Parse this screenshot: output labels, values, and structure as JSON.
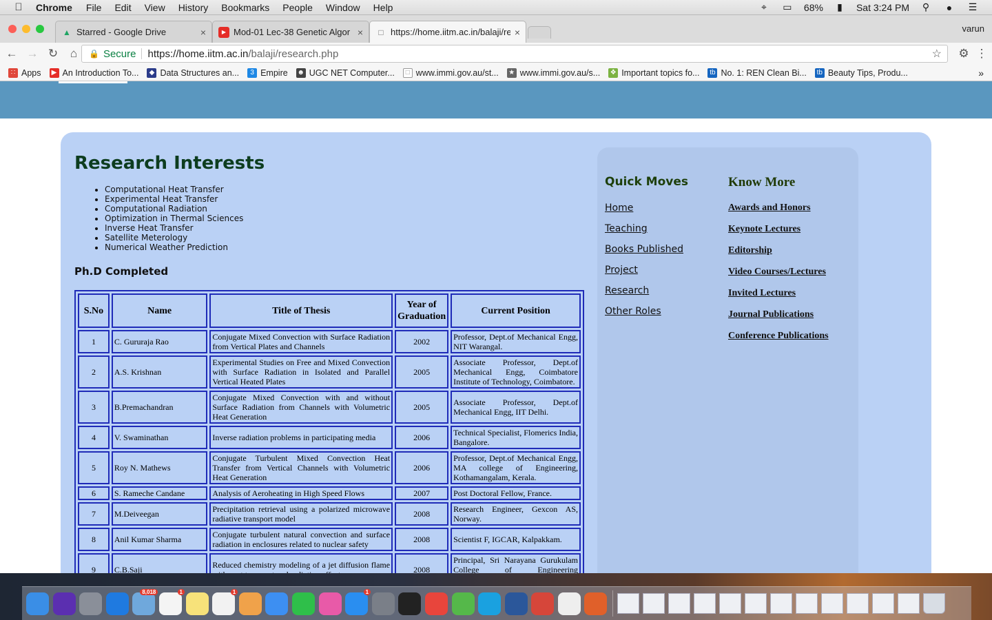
{
  "menubar": {
    "app": "Chrome",
    "items": [
      "File",
      "Edit",
      "View",
      "History",
      "Bookmarks",
      "People",
      "Window",
      "Help"
    ],
    "battery": "68%",
    "clock": "Sat 3:24 PM"
  },
  "tabs": [
    {
      "title": "Starred - Google Drive",
      "icon": "google-drive-icon"
    },
    {
      "title": "Mod-01 Lec-38 Genetic Algor",
      "icon": "youtube-icon"
    },
    {
      "title": "https://home.iitm.ac.in/balaji/re",
      "icon": "page-icon",
      "active": true
    }
  ],
  "profile": "varun",
  "omnibox": {
    "secure_label": "Secure",
    "url_host": "https://home.iitm.ac.in",
    "url_path": "/balaji/research.php"
  },
  "bookmarks": [
    {
      "label": "Apps",
      "color": "#e0483b"
    },
    {
      "label": "An Introduction To...",
      "color": "#e52d27"
    },
    {
      "label": "Data Structures an...",
      "color": "#2b3b8a"
    },
    {
      "label": "Empire",
      "color": "#1e88e5"
    },
    {
      "label": "UGC NET Computer...",
      "color": "#444444"
    },
    {
      "label": "www.immi.gov.au/st...",
      "color": "#999999"
    },
    {
      "label": "www.immi.gov.au/s...",
      "color": "#666666"
    },
    {
      "label": "Important topics fo...",
      "color": "#7cb342"
    },
    {
      "label": "No. 1: REN Clean Bi...",
      "color": "#1565c0"
    },
    {
      "label": "Beauty Tips, Produ...",
      "color": "#1565c0"
    }
  ],
  "page": {
    "research_title": "Research Interests",
    "interests": [
      "Computational Heat Transfer",
      "Experimental Heat Transfer",
      "Computational Radiation",
      "Optimization in Thermal Sciences",
      "Inverse Heat Transfer",
      "Satellite Meterology",
      "Numerical Weather Prediction"
    ],
    "phd_title": "Ph.D Completed",
    "table": {
      "headers": [
        "S.No",
        "Name",
        "Title of Thesis",
        "Year of Graduation",
        "Current Position"
      ],
      "rows": [
        [
          "1",
          "C. Gururaja Rao",
          "Conjugate Mixed Convection with Surface Radiation from Vertical Plates and Channels",
          "2002",
          "Professor, Dept.of Mechanical Engg, NIT Warangal."
        ],
        [
          "2",
          "A.S. Krishnan",
          "Experimental Studies on Free and Mixed Convection with Surface Radiation in Isolated and Parallel Vertical Heated Plates",
          "2005",
          "Associate Professor, Dept.of Mechanical Engg, Coimbatore Institute of Technology, Coimbatore."
        ],
        [
          "3",
          "B.Premachandran",
          "Conjugate Mixed Convection with and without Surface Radiation from Channels with Volumetric Heat Generation",
          "2005",
          "Associate Professor, Dept.of Mechanical Engg, IIT Delhi."
        ],
        [
          "4",
          "V. Swaminathan",
          "Inverse radiation problems in participating media",
          "2006",
          "Technical Specialist, Flomerics India, Bangalore."
        ],
        [
          "5",
          "Roy N. Mathews",
          "Conjugate Turbulent Mixed Convection Heat Transfer from Vertical Channels with Volumetric Heat Generation",
          "2006",
          "Professor, Dept.of Mechanical Engg, MA college of Engineering, Kothamangalam, Kerala."
        ],
        [
          "6",
          "S. Rameche Candane",
          "Analysis of Aeroheating in High Speed Flows",
          "2007",
          "Post Doctoral Fellow, France."
        ],
        [
          "7",
          "M.Deiveegan",
          "Precipitation retrieval using a polarized microwave radiative transport model",
          "2008",
          "Research Engineer, Gexcon AS, Norway."
        ],
        [
          "8",
          "Anil Kumar Sharma",
          "Conjugate turbulent natural convection and surface radiation in enclosures related to nuclear safety",
          "2008",
          "Scientist F, IGCAR, Kalpakkam."
        ],
        [
          "9",
          "C.B.Saji",
          "Reduced chemistry modeling of a jet diffusion flame with soot transport and radiation effects",
          "2008",
          "Principal, Sri Narayana Gurukulam College of Engineering Perumbavoor, Kerala"
        ]
      ]
    },
    "quick_moves": {
      "title": "Quick Moves",
      "links": [
        "Home",
        "Teaching",
        "Books Published",
        "Project",
        "Research",
        "Other Roles"
      ]
    },
    "know_more": {
      "title": "Know More",
      "links": [
        "Awards and Honors",
        "Keynote Lectures",
        "Editorship",
        "Video Courses/Lectures",
        "Invited Lectures",
        "Journal Publications",
        "Conference Publications"
      ]
    }
  },
  "dock": {
    "apps": [
      {
        "name": "finder-icon",
        "color": "#3a8ee6",
        "badge": ""
      },
      {
        "name": "siri-icon",
        "color": "#5b2fb0",
        "badge": ""
      },
      {
        "name": "launchpad-icon",
        "color": "#8a8f99",
        "badge": ""
      },
      {
        "name": "safari-icon",
        "color": "#1f7ae0",
        "badge": ""
      },
      {
        "name": "mail-icon",
        "color": "#6fa8dc",
        "badge": "8,018"
      },
      {
        "name": "calendar-icon",
        "color": "#f4f4f4",
        "badge": "1"
      },
      {
        "name": "notes-icon",
        "color": "#f7e27a",
        "badge": ""
      },
      {
        "name": "reminders-icon",
        "color": "#f2f2f2",
        "badge": "1"
      },
      {
        "name": "photos-icon",
        "color": "#f0a24a",
        "badge": ""
      },
      {
        "name": "messages-icon",
        "color": "#3d8ff2",
        "badge": ""
      },
      {
        "name": "facetime-icon",
        "color": "#2fbf4a",
        "badge": ""
      },
      {
        "name": "itunes-icon",
        "color": "#e85aa8",
        "badge": ""
      },
      {
        "name": "app-store-icon",
        "color": "#2a8ef0",
        "badge": "1"
      },
      {
        "name": "system-preferences-icon",
        "color": "#7a7f88",
        "badge": ""
      },
      {
        "name": "terminal-icon",
        "color": "#222222",
        "badge": ""
      },
      {
        "name": "chrome-icon",
        "color": "#e8453c",
        "badge": ""
      },
      {
        "name": "utorrent-icon",
        "color": "#55b84a",
        "badge": ""
      },
      {
        "name": "skype-icon",
        "color": "#1aa1e0",
        "badge": ""
      },
      {
        "name": "word-icon",
        "color": "#2b579a",
        "badge": ""
      },
      {
        "name": "popcorn-icon",
        "color": "#d6463a",
        "badge": ""
      },
      {
        "name": "textedit-icon",
        "color": "#eeeeee",
        "badge": ""
      },
      {
        "name": "matlab-icon",
        "color": "#e0602a",
        "badge": ""
      }
    ]
  }
}
